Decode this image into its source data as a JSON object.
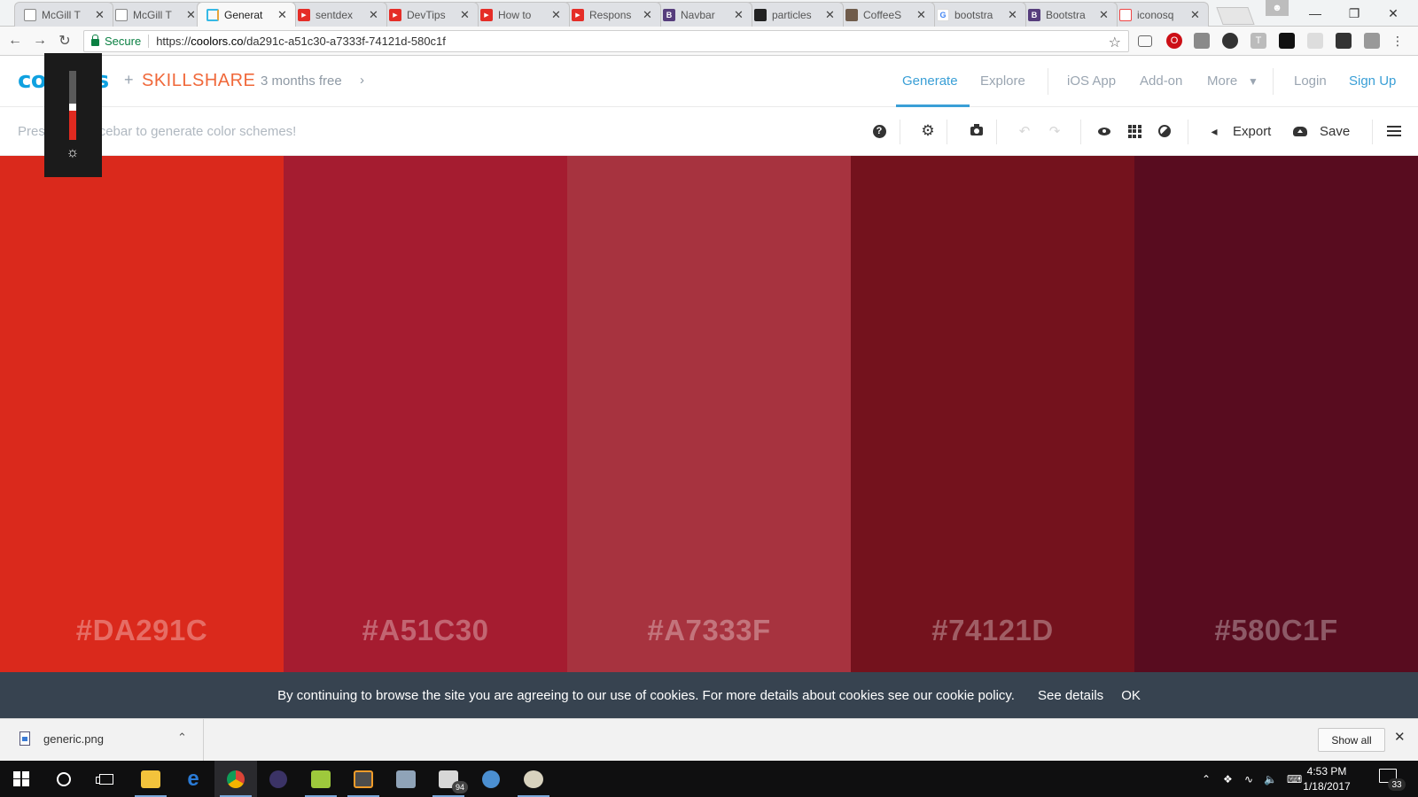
{
  "browser": {
    "tabs": [
      {
        "title": "McGill T",
        "favicon": "doc-icon",
        "active": false
      },
      {
        "title": "McGill T",
        "favicon": "doc-icon",
        "active": false
      },
      {
        "title": "Generat",
        "favicon": "coolors-icon",
        "active": true
      },
      {
        "title": "sentdex",
        "favicon": "youtube-icon",
        "active": false
      },
      {
        "title": "DevTips",
        "favicon": "youtube-icon",
        "active": false
      },
      {
        "title": "How to",
        "favicon": "youtube-icon",
        "active": false
      },
      {
        "title": "Respons",
        "favicon": "youtube-icon",
        "active": false
      },
      {
        "title": "Navbar",
        "favicon": "bootstrap-icon",
        "active": false
      },
      {
        "title": "particles",
        "favicon": "github-icon",
        "active": false
      },
      {
        "title": "CoffeeS",
        "favicon": "coffee-icon",
        "active": false
      },
      {
        "title": "bootstra",
        "favicon": "google-icon",
        "active": false
      },
      {
        "title": "Bootstra",
        "favicon": "bootstrap-icon",
        "active": false
      },
      {
        "title": "iconosq",
        "favicon": "iconosquare-icon",
        "active": false
      }
    ],
    "secure_label": "Secure",
    "url_scheme": "https://",
    "url_host": "coolors.co",
    "url_path": "/da291c-a51c30-a7333f-74121d-580c1f"
  },
  "header": {
    "logo": "coolors",
    "partner": "SKILLSHARE",
    "promo": "3 months free",
    "nav": [
      {
        "label": "Generate",
        "active": true
      },
      {
        "label": "Explore",
        "active": false
      },
      {
        "label": "iOS App",
        "active": false
      },
      {
        "label": "Add-on",
        "active": false
      },
      {
        "label": "More",
        "active": false
      }
    ],
    "login": "Login",
    "signup": "Sign Up"
  },
  "toolbar": {
    "hint": "Press the spacebar to generate color schemes!",
    "export_label": "Export",
    "save_label": "Save"
  },
  "brightness": {
    "level": 0.42
  },
  "palette": {
    "colors": [
      {
        "hex": "#DA291C",
        "value": "#da291c"
      },
      {
        "hex": "#A51C30",
        "value": "#a51c30"
      },
      {
        "hex": "#A7333F",
        "value": "#a7333f"
      },
      {
        "hex": "#74121D",
        "value": "#74121d"
      },
      {
        "hex": "#580C1F",
        "value": "#580c1f"
      }
    ]
  },
  "cookie": {
    "message": "By continuing to browse the site you are agreeing to our use of cookies. For more details about cookies see our cookie policy.",
    "details": "See details",
    "ok": "OK"
  },
  "downloads": {
    "file": "generic.png",
    "show_all": "Show all"
  },
  "taskbar": {
    "time": "4:53 PM",
    "date": "1/18/2017",
    "mail_count": "94",
    "notifications": "33"
  }
}
